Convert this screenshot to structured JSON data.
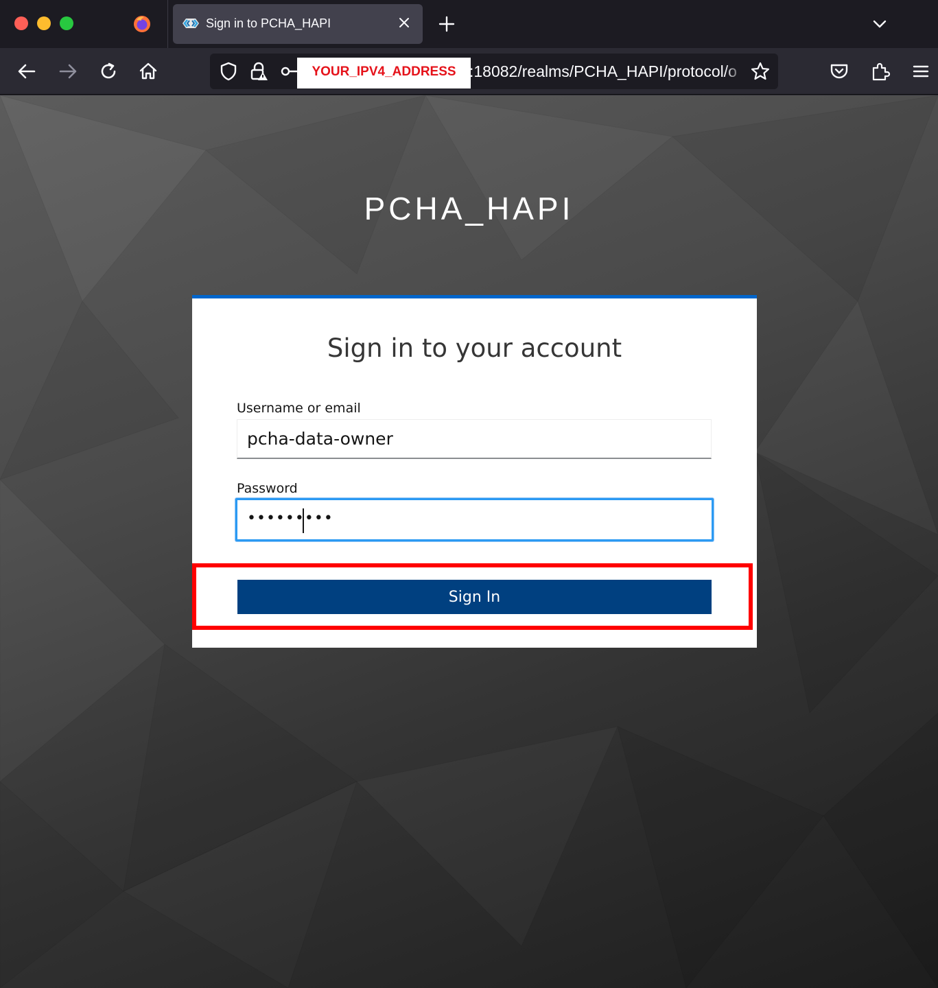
{
  "browser": {
    "tab": {
      "title": "Sign in to PCHA_HAPI",
      "favicon": "keycloak-icon"
    },
    "url": {
      "visible_text": ":18082/realms/PCHA_HAPI/protocol/o",
      "redaction_label": "YOUR_IPV4_ADDRESS"
    },
    "toolbar_icons": [
      "back-arrow-icon",
      "forward-arrow-icon",
      "reload-icon",
      "home-icon",
      "tracking-shield-icon",
      "insecure-lock-icon",
      "permissions-key-icon",
      "bookmark-star-icon",
      "pocket-icon",
      "extensions-icon",
      "menu-icon"
    ]
  },
  "page": {
    "realm_title": "PCHA_HAPI",
    "card_title": "Sign in to your account",
    "username": {
      "label": "Username or email",
      "value": "pcha-data-owner"
    },
    "password": {
      "label": "Password",
      "masked_value": "•••••••••"
    },
    "submit_label": "Sign In"
  },
  "colors": {
    "card_top_border": "#0066cc",
    "button": "#004080",
    "focus_ring": "#2b9af3",
    "annotation_box": "#ff0000"
  }
}
